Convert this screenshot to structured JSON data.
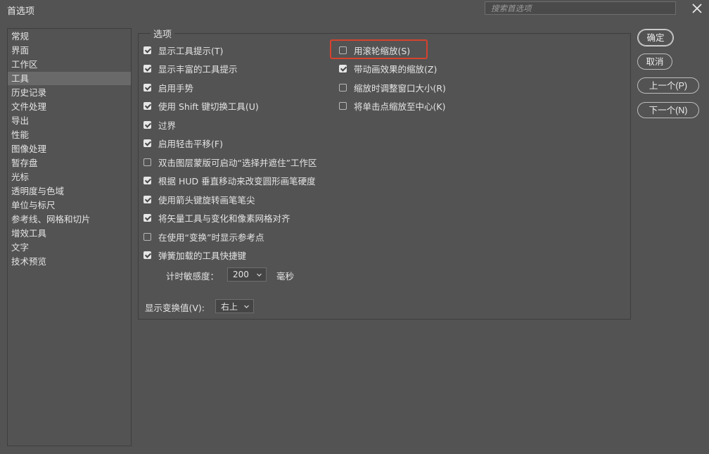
{
  "window": {
    "title": "首选项",
    "search_placeholder": "搜索首选项"
  },
  "sidebar": {
    "selected": "工具",
    "items": [
      "常规",
      "界面",
      "工作区",
      "工具",
      "历史记录",
      "文件处理",
      "导出",
      "性能",
      "图像处理",
      "暂存盘",
      "光标",
      "透明度与色域",
      "单位与标尺",
      "参考线、网格和切片",
      "增效工具",
      "文字",
      "技术预览"
    ]
  },
  "options": {
    "group_label": "选项",
    "left_checkboxes": [
      {
        "label": "显示工具提示(T)",
        "checked": true
      },
      {
        "label": "显示丰富的工具提示",
        "checked": true
      },
      {
        "label": "启用手势",
        "checked": true
      },
      {
        "label": "使用 Shift 键切换工具(U)",
        "checked": true
      },
      {
        "label": "过界",
        "checked": true
      },
      {
        "label": "启用轻击平移(F)",
        "checked": true
      },
      {
        "label": "双击图层蒙版可启动“选择并遮住”工作区",
        "checked": false
      },
      {
        "label": "根据 HUD 垂直移动来改变圆形画笔硬度",
        "checked": true
      },
      {
        "label": "使用箭头键旋转画笔笔尖",
        "checked": true
      },
      {
        "label": "将矢量工具与变化和像素网格对齐",
        "checked": true
      },
      {
        "label": "在使用“变换”时显示参考点",
        "checked": false
      },
      {
        "label": "弹簧加载的工具快捷键",
        "checked": true
      }
    ],
    "right_checkboxes": [
      {
        "label": "用滚轮缩放(S)",
        "checked": false
      },
      {
        "label": "带动画效果的缩放(Z)",
        "checked": true
      },
      {
        "label": "缩放时调整窗口大小(R)",
        "checked": false
      },
      {
        "label": "将单击点缩放至中心(K)",
        "checked": false
      }
    ],
    "timer": {
      "label": "计时敏感度：",
      "value": "200",
      "unit": "毫秒"
    },
    "transform_values": {
      "label": "显示变换值(V):",
      "value": "右上"
    }
  },
  "buttons": {
    "ok": "确定",
    "cancel": "取消",
    "prev": "上一个(P)",
    "next": "下一个(N)"
  },
  "colors": {
    "background": "#535353",
    "highlight_border": "#d7422e",
    "selected_item": "#696969"
  },
  "icons": {
    "close": "close-icon",
    "dropdown": "chevron-down-icon"
  }
}
